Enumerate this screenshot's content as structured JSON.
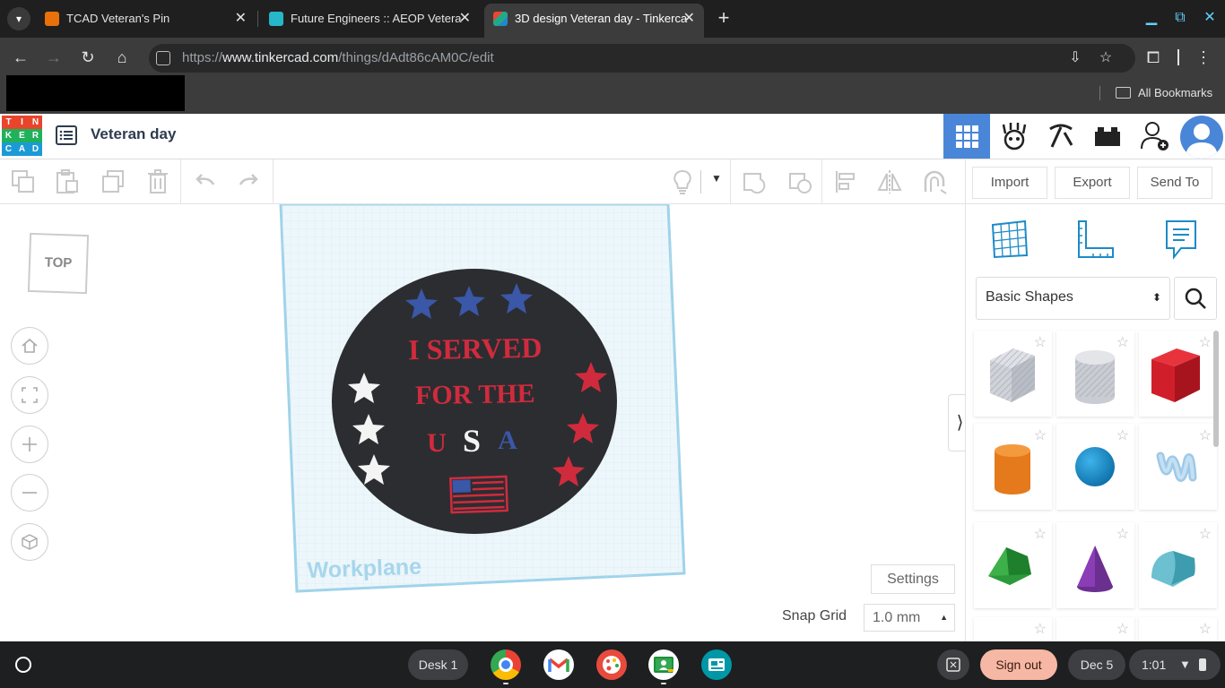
{
  "browser": {
    "tabs": [
      {
        "title": "TCAD Veteran's Pin",
        "active": false
      },
      {
        "title": "Future Engineers :: AEOP Vetera",
        "active": false
      },
      {
        "title": "3D design Veteran day - Tinkerca",
        "active": true
      }
    ],
    "url_prefix": "https://",
    "url_host": "www.tinkercad.com",
    "url_path": "/things/dAdt86cAM0C/edit",
    "all_bookmarks": "All Bookmarks"
  },
  "app": {
    "logo_letters": [
      "T",
      "I",
      "N",
      "K",
      "E",
      "R",
      "C",
      "A",
      "D"
    ],
    "design_title": "Veteran day"
  },
  "actions": {
    "import": "Import",
    "export": "Export",
    "send_to": "Send To"
  },
  "workspace": {
    "viewcube_label": "TOP",
    "workplane_label": "Workplane",
    "pin_text": {
      "line1": "I SERVED",
      "line2": "FOR THE",
      "usa_u": "U",
      "usa_s": "S",
      "usa_a": "A"
    },
    "settings": "Settings",
    "snap_grid_label": "Snap Grid",
    "snap_grid_value": "1.0 mm"
  },
  "panel": {
    "category": "Basic Shapes",
    "shapes": [
      "Box Hole",
      "Cylinder Hole",
      "Box",
      "Cylinder",
      "Sphere",
      "Scribble",
      "Roof",
      "Cone",
      "Round Roof"
    ]
  },
  "shelf": {
    "desk": "Desk 1",
    "sign_out": "Sign out",
    "date": "Dec 5",
    "time": "1:01"
  },
  "colors": {
    "tinkercad_blue": "#4a86d8",
    "pin_red": "#d02b3d",
    "pin_blue": "#3a57a8",
    "pin_dark": "#2c2d31"
  }
}
